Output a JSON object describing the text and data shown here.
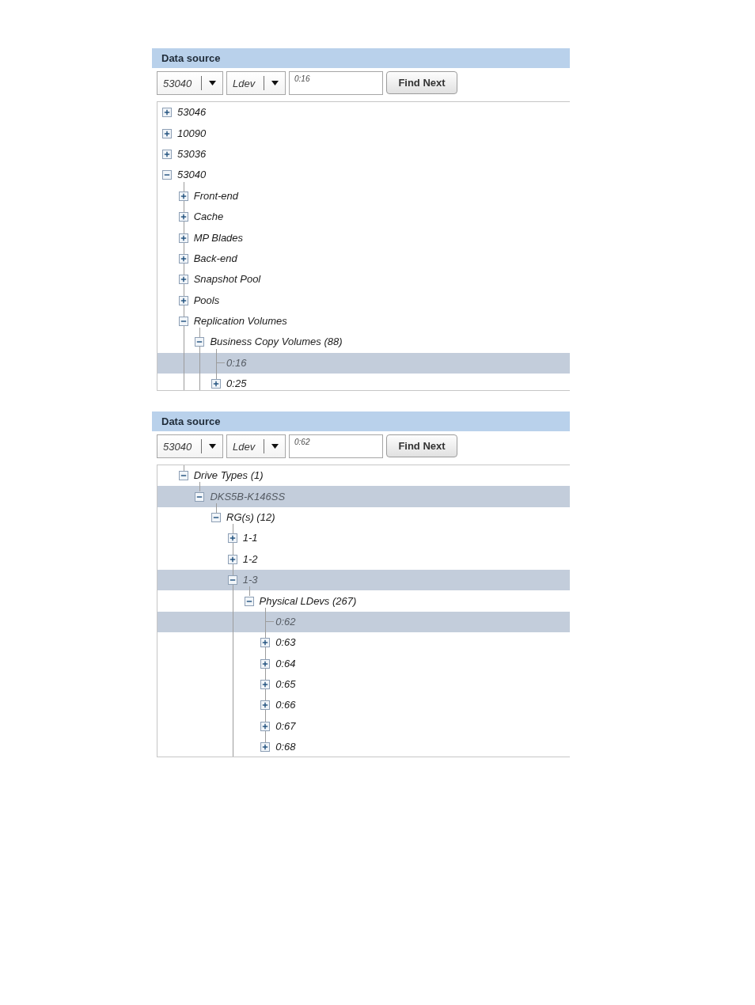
{
  "panels": [
    {
      "title": "Data source",
      "dropdowns": [
        {
          "value": "53040"
        },
        {
          "value": "Ldev"
        }
      ],
      "search": {
        "value": "0:16"
      },
      "button": "Find Next",
      "tree": [
        {
          "label": "53046",
          "kind": "branch",
          "expanded": false,
          "selected": false
        },
        {
          "label": "10090",
          "kind": "branch",
          "expanded": false,
          "selected": false
        },
        {
          "label": "53036",
          "kind": "branch",
          "expanded": false,
          "selected": false
        },
        {
          "label": "53040",
          "kind": "branch",
          "expanded": true,
          "more_children_below": true,
          "selected": false,
          "children": [
            {
              "label": "Front-end",
              "kind": "branch",
              "expanded": false,
              "selected": false
            },
            {
              "label": "Cache",
              "kind": "branch",
              "expanded": false,
              "selected": false
            },
            {
              "label": "MP Blades",
              "kind": "branch",
              "expanded": false,
              "selected": false
            },
            {
              "label": "Back-end",
              "kind": "branch",
              "expanded": false,
              "selected": false
            },
            {
              "label": "Snapshot Pool",
              "kind": "branch",
              "expanded": false,
              "selected": false
            },
            {
              "label": "Pools",
              "kind": "branch",
              "expanded": false,
              "selected": false
            },
            {
              "label": "Replication Volumes",
              "kind": "branch",
              "expanded": true,
              "more_children_below": true,
              "selected": false,
              "children": [
                {
                  "label": "Business Copy Volumes (88)",
                  "kind": "branch",
                  "expanded": true,
                  "more_children_below": false,
                  "selected": false,
                  "children": [
                    {
                      "label": "0:16",
                      "kind": "leaf",
                      "selected": true
                    },
                    {
                      "label": "0:25",
                      "kind": "branch",
                      "expanded": false,
                      "selected": false
                    }
                  ]
                }
              ]
            }
          ]
        }
      ]
    },
    {
      "title": "Data source",
      "dropdowns": [
        {
          "value": "53040"
        },
        {
          "value": "Ldev"
        }
      ],
      "search": {
        "value": "0:62"
      },
      "button": "Find Next",
      "tree": [
        {
          "label": "Drive Types (1)",
          "kind": "branch",
          "expanded": true,
          "more_children_below": false,
          "selected": false,
          "children": [
            {
              "label": "DKS5B-K146SS",
              "kind": "branch",
              "expanded": true,
              "more_children_below": false,
              "selected": true,
              "children": [
                {
                  "label": "RG(s) (12)",
                  "kind": "branch",
                  "expanded": true,
                  "more_children_below": true,
                  "selected": false,
                  "children": [
                    {
                      "label": "1-1",
                      "kind": "branch",
                      "expanded": false,
                      "selected": false
                    },
                    {
                      "label": "1-2",
                      "kind": "branch",
                      "expanded": false,
                      "selected": false
                    },
                    {
                      "label": "1-3",
                      "kind": "branch",
                      "expanded": true,
                      "more_children_below": false,
                      "selected": true,
                      "children": [
                        {
                          "label": "Physical LDevs (267)",
                          "kind": "branch",
                          "expanded": true,
                          "more_children_below": false,
                          "selected": false,
                          "children": [
                            {
                              "label": "0:62",
                              "kind": "leaf",
                              "selected": true
                            },
                            {
                              "label": "0:63",
                              "kind": "branch",
                              "expanded": false,
                              "selected": false
                            },
                            {
                              "label": "0:64",
                              "kind": "branch",
                              "expanded": false,
                              "selected": false
                            },
                            {
                              "label": "0:65",
                              "kind": "branch",
                              "expanded": false,
                              "selected": false
                            },
                            {
                              "label": "0:66",
                              "kind": "branch",
                              "expanded": false,
                              "selected": false
                            },
                            {
                              "label": "0:67",
                              "kind": "branch",
                              "expanded": false,
                              "selected": false
                            },
                            {
                              "label": "0:68",
                              "kind": "branch",
                              "expanded": false,
                              "selected": false
                            }
                          ]
                        }
                      ]
                    }
                  ]
                }
              ]
            }
          ]
        }
      ]
    }
  ]
}
